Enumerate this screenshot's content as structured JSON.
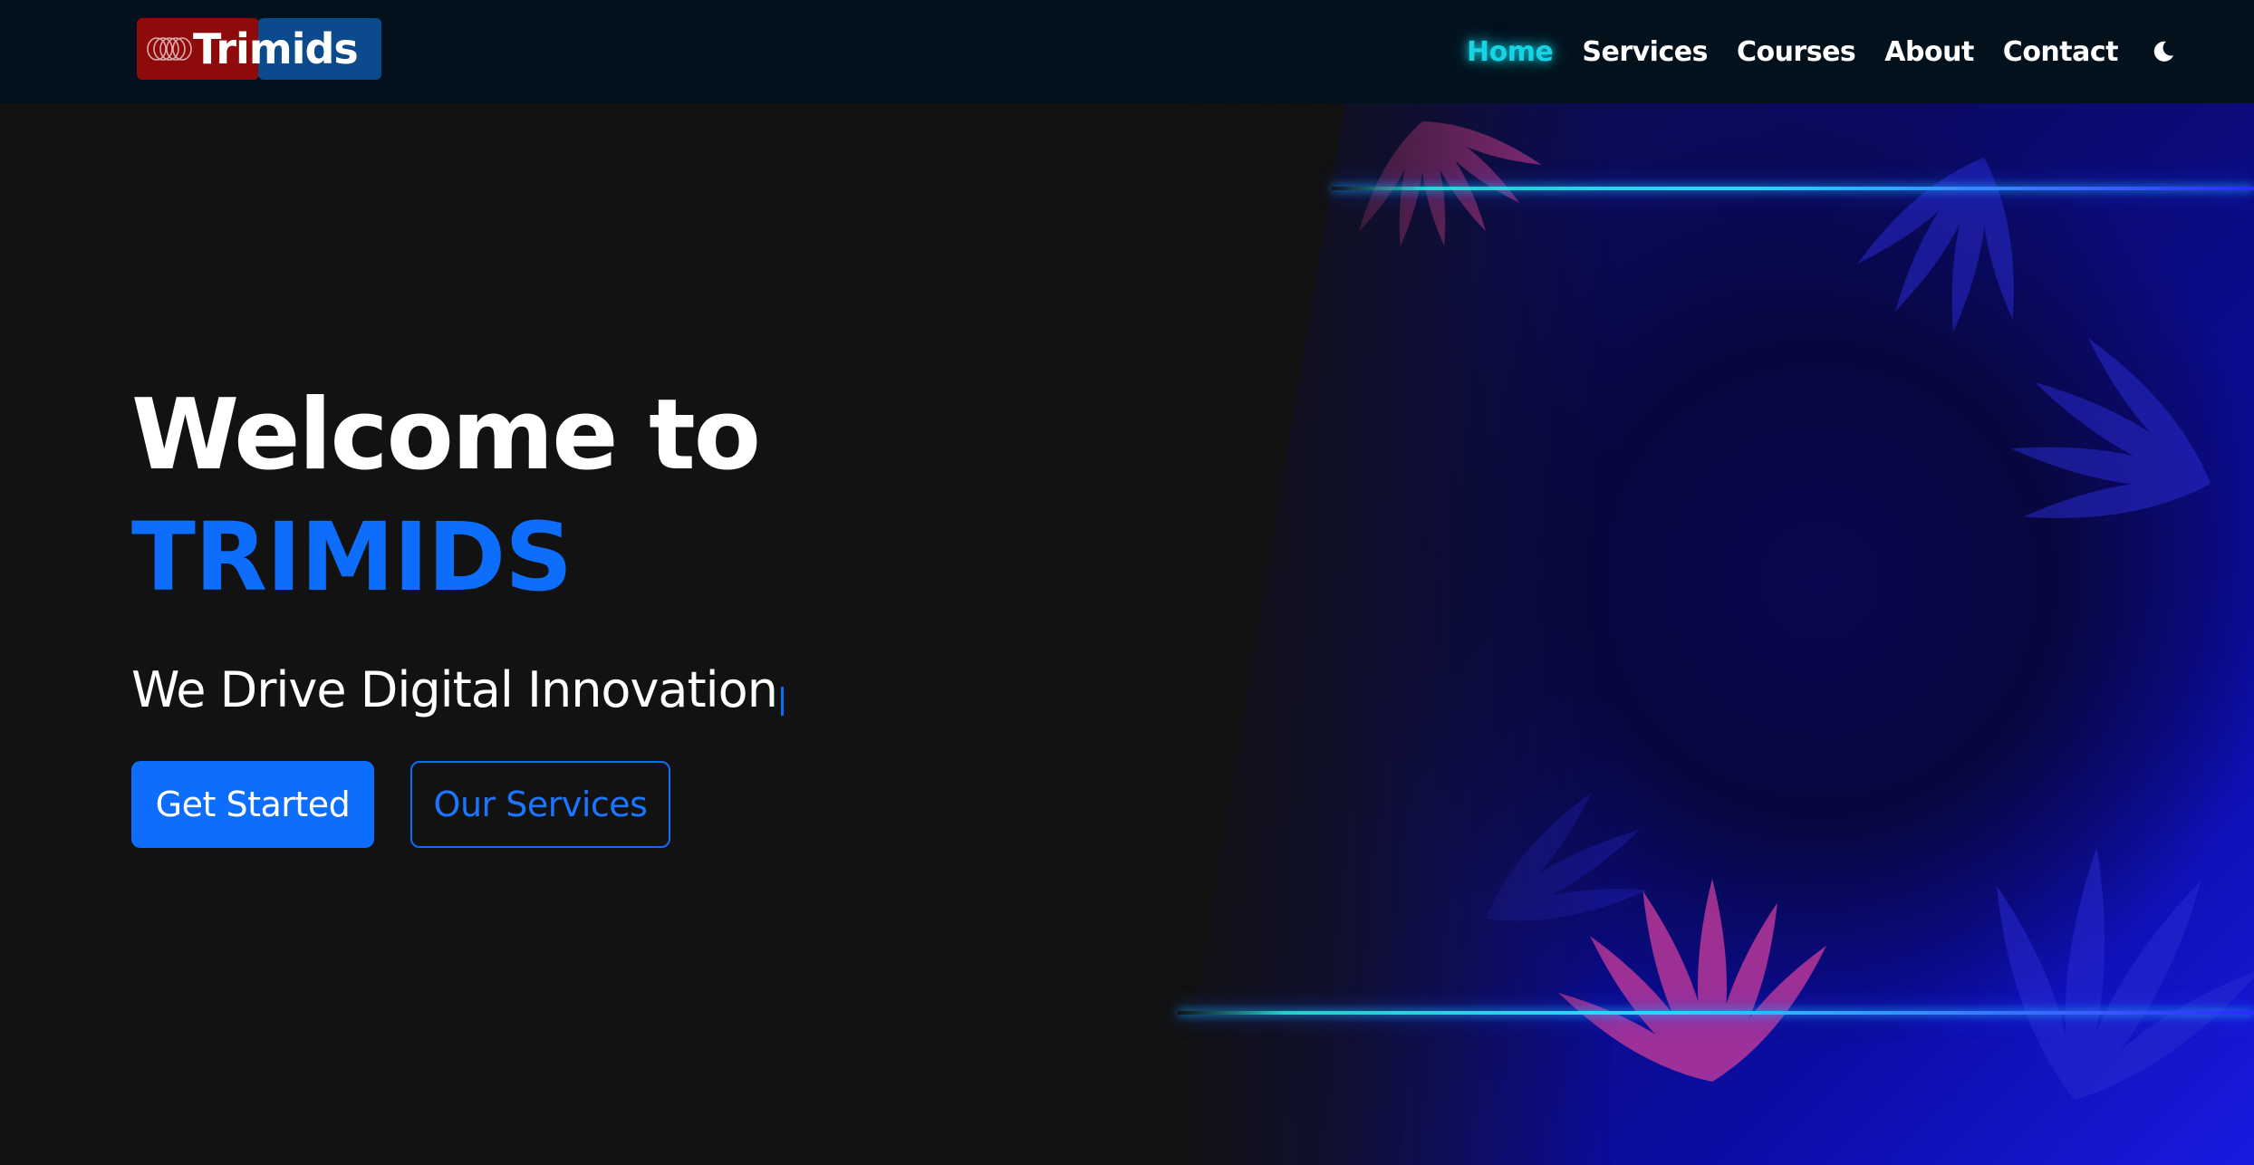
{
  "navbar": {
    "brand": "Trimids",
    "links": [
      {
        "label": "Home",
        "active": true
      },
      {
        "label": "Services",
        "active": false
      },
      {
        "label": "Courses",
        "active": false
      },
      {
        "label": "About",
        "active": false
      },
      {
        "label": "Contact",
        "active": false
      }
    ],
    "theme_toggle_icon": "moon-icon"
  },
  "hero": {
    "title_line1": "Welcome to",
    "title_line2": "TRIMIDS",
    "tagline": "We Drive Digital Innovation",
    "primary_button": "Get Started",
    "secondary_button": "Our Services"
  },
  "colors": {
    "navbar_bg": "#03111c",
    "page_bg": "#121212",
    "accent_blue": "#0d6efd",
    "active_link": "#17d4e4",
    "brand_red": "#8f0a0a",
    "brand_blue": "#0b4a8c"
  }
}
